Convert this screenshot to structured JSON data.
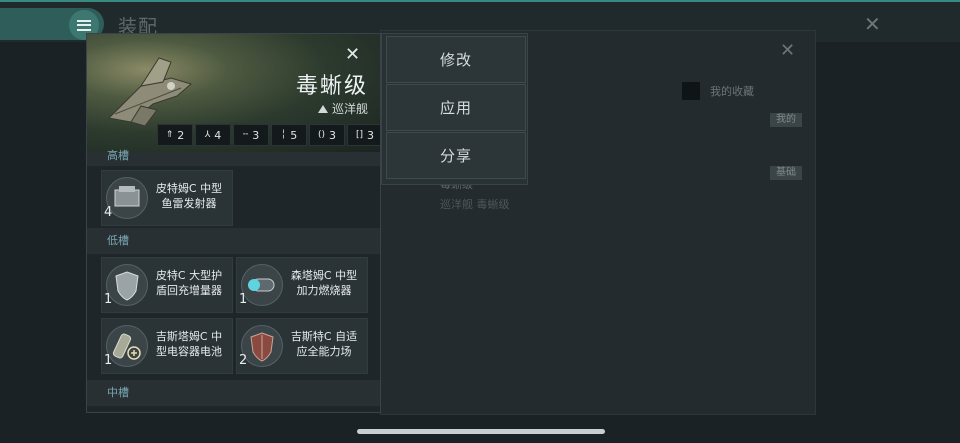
{
  "top": {
    "title": "装配"
  },
  "background": {
    "favorites_label": "我的收藏",
    "tag_mine": "我的",
    "tag_basic": "基础",
    "list_item_name": "毒蜥级",
    "list_item_sub": "巡洋舰 毒蜥级"
  },
  "context_menu": {
    "items": [
      "修改",
      "应用",
      "分享"
    ]
  },
  "ship": {
    "name": "毒蜥级",
    "class": "巡洋舰",
    "stats": [
      {
        "icon": "turret-hardpoint-icon",
        "value": "2"
      },
      {
        "icon": "launcher-hardpoint-icon",
        "value": "4"
      },
      {
        "icon": "high-slot-icon",
        "value": "3"
      },
      {
        "icon": "mid-slot-icon",
        "value": "5"
      },
      {
        "icon": "low-slot-icon",
        "value": "3"
      },
      {
        "icon": "rig-slot-icon",
        "value": "3"
      }
    ]
  },
  "sections": {
    "high_label": "高槽",
    "low_label": "低槽",
    "mid_label": "中槽"
  },
  "high_slots": [
    {
      "name": "皮特姆C 中型鱼雷发射器",
      "line1": "皮特姆C 中型",
      "line2": "鱼雷发射器",
      "count": "4",
      "icon": "torpedo-launcher-icon"
    }
  ],
  "low_slots": [
    {
      "line1": "皮特C 大型护",
      "line2": "盾回充增量器",
      "count": "1",
      "icon": "shield-extender-icon"
    },
    {
      "line1": "森塔姆C 中型",
      "line2": "加力燃烧器",
      "count": "1",
      "icon": "afterburner-icon"
    },
    {
      "line1": "吉斯塔姆C 中",
      "line2": "型电容器电池",
      "count": "1",
      "icon": "capacitor-battery-icon"
    },
    {
      "line1": "吉斯特C 自适",
      "line2": "应全能力场",
      "count": "2",
      "icon": "adaptive-field-icon"
    }
  ]
}
